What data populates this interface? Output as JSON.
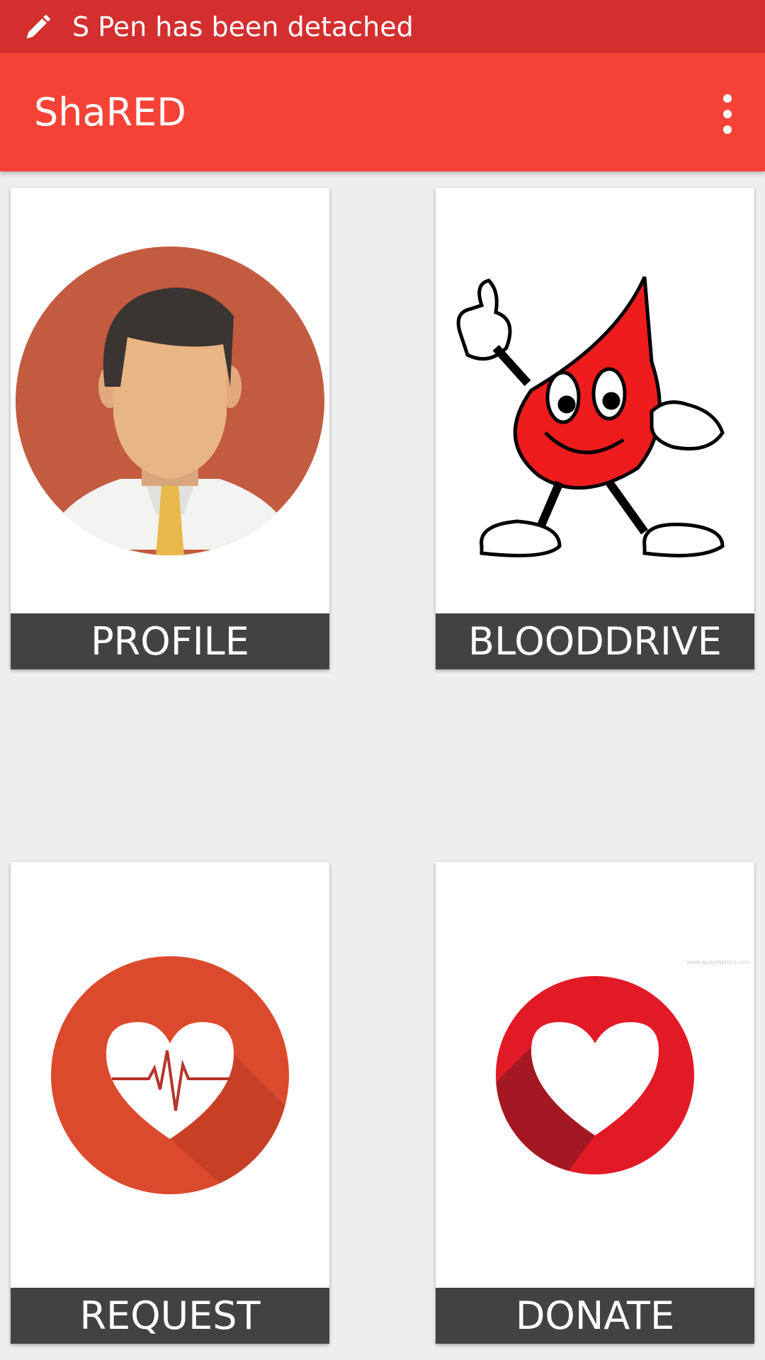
{
  "status_bar": {
    "notification": "S Pen has been detached",
    "icon": "pen-icon"
  },
  "app_bar": {
    "title": "ShaRED",
    "menu_icon": "more-vert-icon"
  },
  "tiles": [
    {
      "label": "PROFILE",
      "icon": "profile-avatar"
    },
    {
      "label": "BLOODDRIVE",
      "icon": "blood-drop-mascot"
    },
    {
      "label": "REQUEST",
      "icon": "heartbeat-heart"
    },
    {
      "label": "DONATE",
      "icon": "heart",
      "watermark": "www.psdgraphics.com"
    }
  ],
  "colors": {
    "status": "#d32f2f",
    "appbar": "#f44336",
    "label_bg": "#424242"
  }
}
